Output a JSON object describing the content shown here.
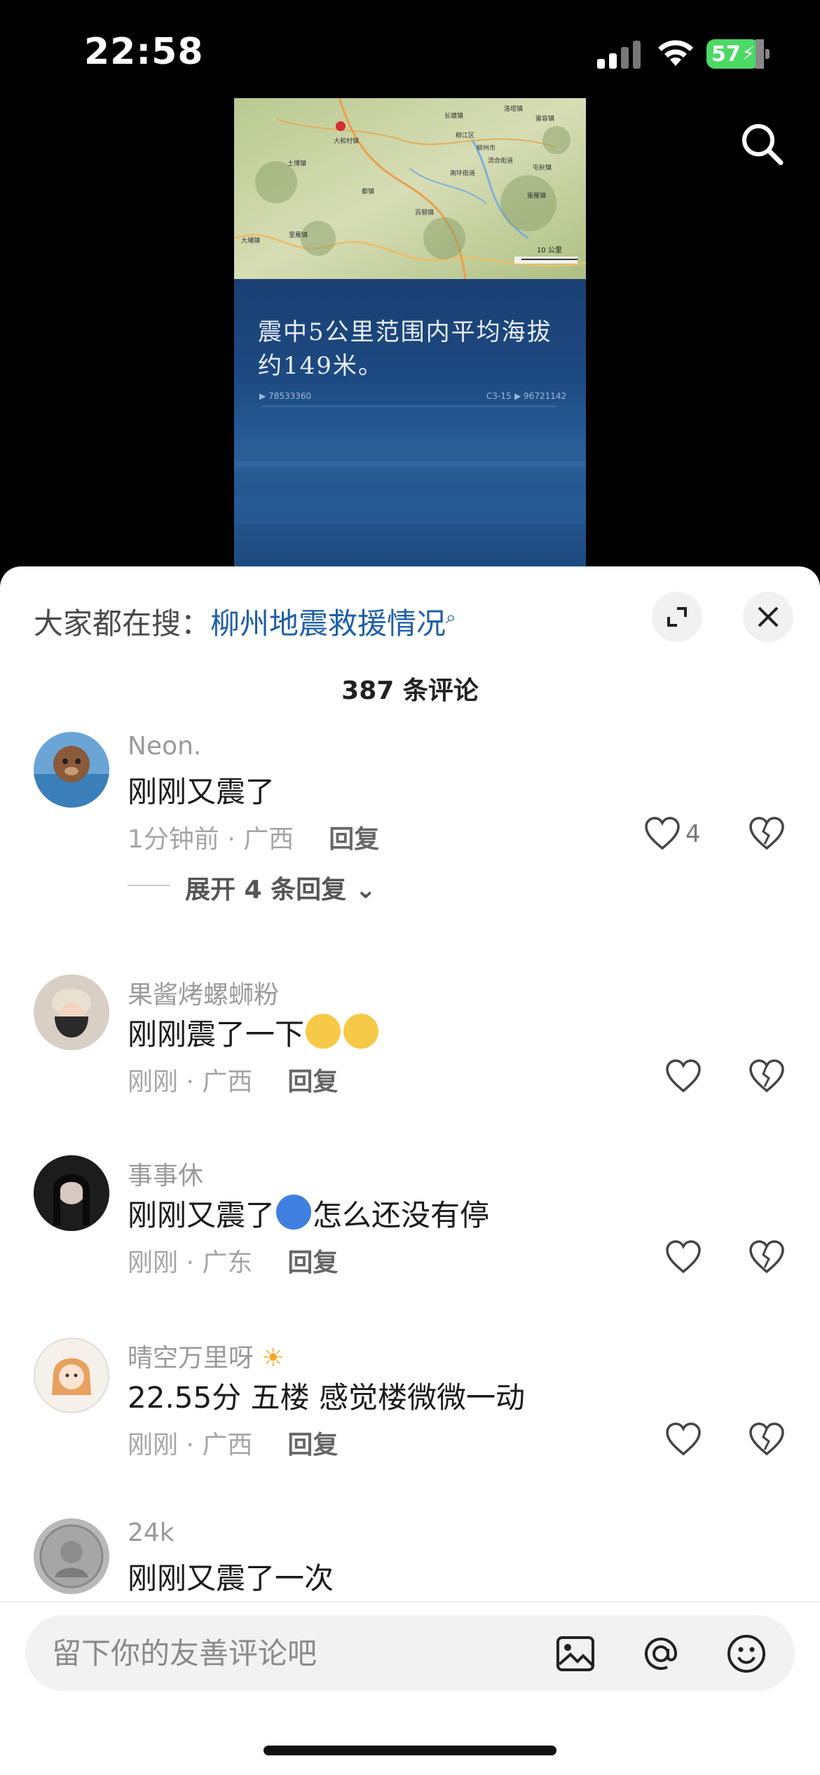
{
  "status": {
    "time": "22:58",
    "battery": "57"
  },
  "video": {
    "caption": "震中5公里范围内平均海拔约149米。",
    "meta_left": "▶ 78533360",
    "meta_mid": "C3-15",
    "meta_right": "▶ 96721142",
    "map": {
      "labels": [
        "大和村镇",
        "长塘镇",
        "洛塔镇",
        "雷容镇",
        "柳江区",
        "柳州市",
        "土博镇",
        "南环街道",
        "屯秋镇",
        "都镇",
        "流合街道",
        "雷雁镇",
        "大埔镇",
        "里雁镇",
        "百朋镇"
      ],
      "scale": "10 公里"
    }
  },
  "panel": {
    "hot_search_prefix": "大家都在搜：",
    "hot_search_query": "柳州地震救援情况",
    "comment_count": "387 条评论",
    "expand_label": "展开 4 条回复",
    "reply_label": "回复",
    "comments": [
      {
        "user": "Neon.",
        "text": "刚刚又震了",
        "meta": "1分钟前 · 广西",
        "likes": "4"
      },
      {
        "user": "果酱烤螺蛳粉",
        "text": "刚刚震了一下",
        "meta": "刚刚 · 广西",
        "likes": ""
      },
      {
        "user": "事事休",
        "text_a": "刚刚又震了",
        "text_b": "怎么还没有停",
        "meta": "刚刚 · 广东",
        "likes": ""
      },
      {
        "user": "晴空万里呀",
        "text": "22.55分 五楼 感觉楼微微一动",
        "meta": "刚刚 · 广西",
        "likes": ""
      },
      {
        "user": "24k",
        "text": "刚刚又震了一次",
        "meta": "",
        "likes": ""
      }
    ],
    "input_placeholder": "留下你的友善评论吧"
  },
  "colors": {
    "link": "#1f5fa8",
    "battery": "#4cd964"
  }
}
